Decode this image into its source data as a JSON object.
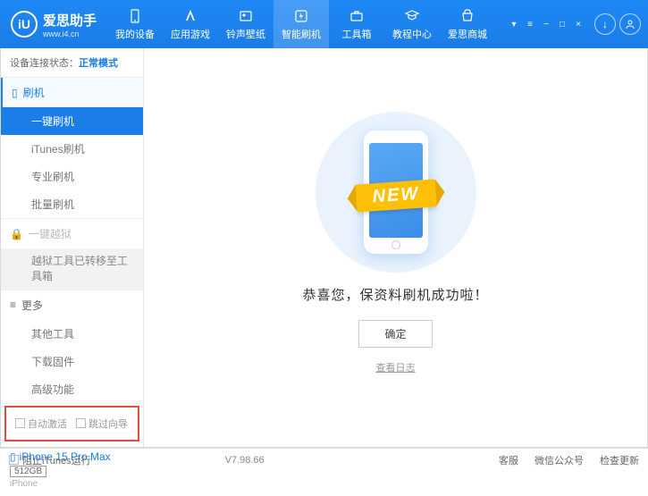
{
  "header": {
    "logo_letter": "iU",
    "title": "爱思助手",
    "subtitle": "www.i4.cn",
    "tabs": [
      "我的设备",
      "应用游戏",
      "铃声壁纸",
      "智能刷机",
      "工具箱",
      "教程中心",
      "爱思商城"
    ],
    "active_tab": 3
  },
  "sidebar": {
    "status_label": "设备连接状态：",
    "status_value": "正常模式",
    "flash_section": "刷机",
    "flash_items": [
      "一键刷机",
      "iTunes刷机",
      "专业刷机",
      "批量刷机"
    ],
    "flash_active": 0,
    "jailbreak_section": "一键越狱",
    "jailbreak_note": "越狱工具已转移至工具箱",
    "more_section": "更多",
    "more_items": [
      "其他工具",
      "下载固件",
      "高级功能"
    ],
    "checkbox1": "自动激活",
    "checkbox2": "跳过向导",
    "device_name": "iPhone 15 Pro Max",
    "device_storage": "512GB",
    "device_type": "iPhone"
  },
  "main": {
    "new_label": "NEW",
    "success_msg": "恭喜您，保资料刷机成功啦！",
    "ok_button": "确定",
    "log_link": "查看日志"
  },
  "footer": {
    "block_itunes": "阻止iTunes运行",
    "version": "V7.98.66",
    "links": [
      "客服",
      "微信公众号",
      "检查更新"
    ]
  }
}
